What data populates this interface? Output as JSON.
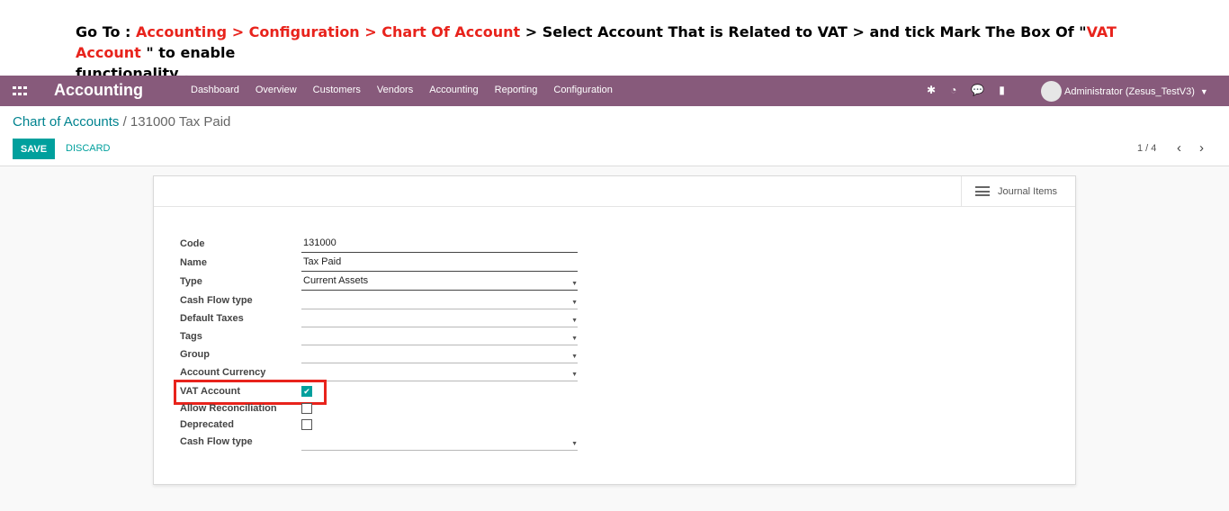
{
  "instruction": {
    "prefix": "Go To : ",
    "path": "Accounting > Configuration > Chart Of Account",
    "middle": " > Select Account That is Related to VAT > and tick Mark The Box Of \"",
    "field": "VAT Account",
    "suffix": " \" to enable",
    "line2": "functionality ."
  },
  "navbar": {
    "app_title": "Accounting",
    "menu": [
      "Dashboard",
      "Overview",
      "Customers",
      "Vendors",
      "Accounting",
      "Reporting",
      "Configuration"
    ],
    "user": "Administrator (Zesus_TestV3)",
    "colors": {
      "bar": "#875a7b",
      "accent": "#00a09d",
      "highlight": "#e8231c"
    }
  },
  "breadcrumb": {
    "parent": "Chart of Accounts",
    "separator": "/",
    "current": "131000 Tax Paid"
  },
  "buttons": {
    "save": "SAVE",
    "discard": "DISCARD"
  },
  "pager": {
    "value": "1 / 4"
  },
  "stat_button": {
    "label": "Journal Items"
  },
  "form": {
    "code_label": "Code",
    "code_value": "131000",
    "name_label": "Name",
    "name_value": "Tax Paid",
    "type_label": "Type",
    "type_value": "Current Assets",
    "cash_flow_label": "Cash Flow type",
    "cash_flow_value": "",
    "default_taxes_label": "Default Taxes",
    "default_taxes_value": "",
    "tags_label": "Tags",
    "tags_value": "",
    "group_label": "Group",
    "group_value": "",
    "currency_label": "Account Currency",
    "currency_value": "",
    "vat_label": "VAT Account",
    "vat_checked": true,
    "reconcile_label": "Allow Reconciliation",
    "reconcile_checked": false,
    "deprecated_label": "Deprecated",
    "deprecated_checked": false,
    "cash_flow2_label": "Cash Flow type",
    "cash_flow2_value": ""
  }
}
